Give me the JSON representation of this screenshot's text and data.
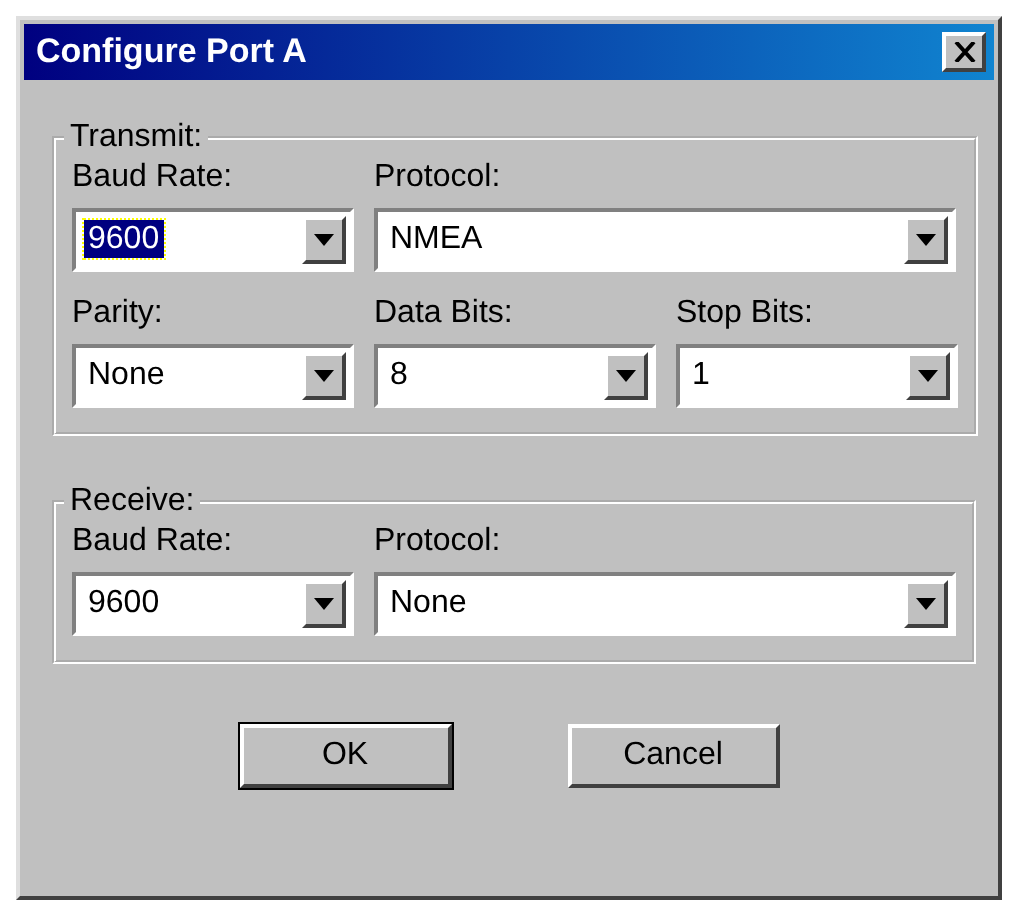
{
  "window": {
    "title": "Configure Port A"
  },
  "groups": [
    {
      "title": "Transmit:",
      "rows": [
        [
          {
            "label": "Baud Rate:",
            "value": "9600",
            "kind": "narrow",
            "focused": true
          },
          {
            "label": "Protocol:",
            "value": "NMEA",
            "kind": "wide",
            "focused": false
          }
        ],
        [
          {
            "label": "Parity:",
            "value": "None",
            "kind": "narrow",
            "focused": false
          },
          {
            "label": "Data Bits:",
            "value": "8",
            "kind": "narrow",
            "focused": false
          },
          {
            "label": "Stop Bits:",
            "value": "1",
            "kind": "narrow",
            "focused": false
          }
        ]
      ]
    },
    {
      "title": "Receive:",
      "rows": [
        [
          {
            "label": "Baud Rate:",
            "value": "9600",
            "kind": "narrow",
            "focused": false
          },
          {
            "label": "Protocol:",
            "value": "None",
            "kind": "wide",
            "focused": false
          }
        ]
      ]
    }
  ],
  "buttons": [
    {
      "label": "OK",
      "default": true
    },
    {
      "label": "Cancel",
      "default": false
    }
  ]
}
